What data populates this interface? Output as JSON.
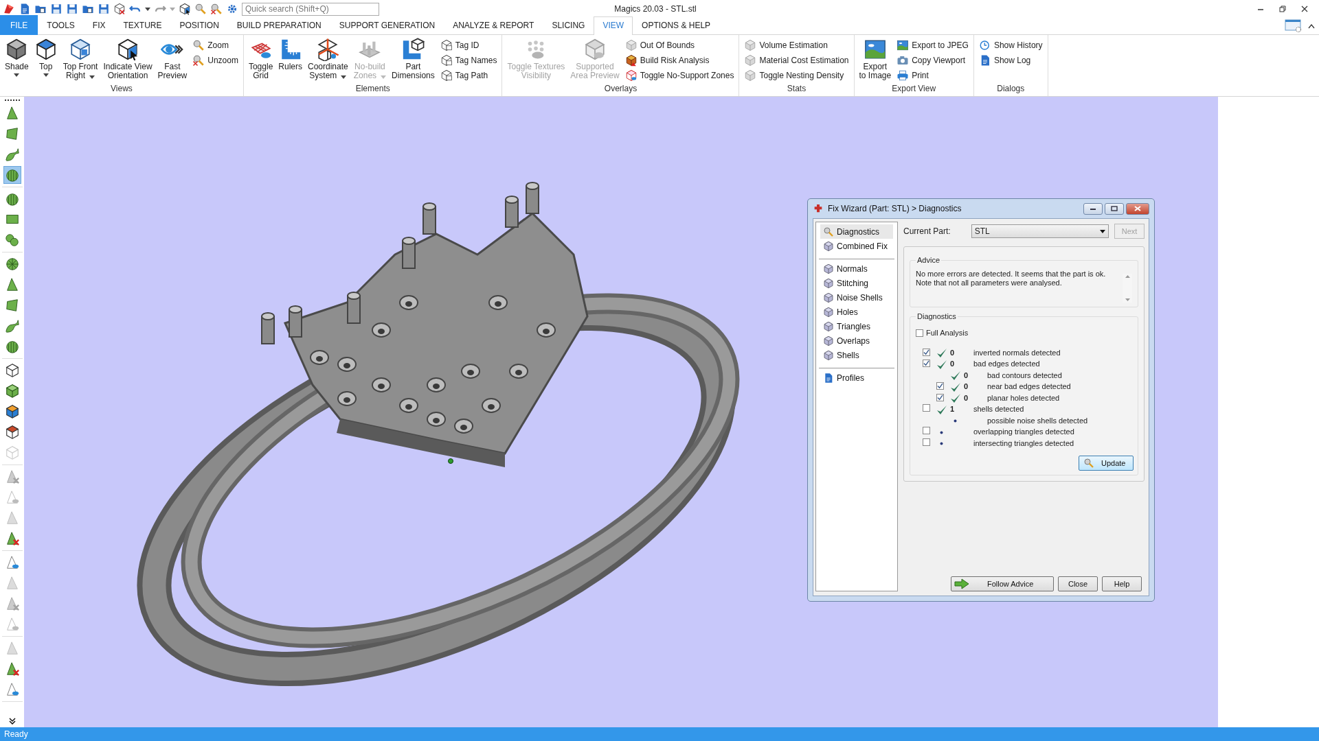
{
  "window": {
    "title": "Magics 20.03 - STL.stl"
  },
  "quick_search": {
    "placeholder": "Quick search (Shift+Q)"
  },
  "tabs": [
    {
      "label": "FILE",
      "kind": "file",
      "selected": false
    },
    {
      "label": "TOOLS",
      "kind": "tab",
      "selected": false
    },
    {
      "label": "FIX",
      "kind": "tab",
      "selected": false
    },
    {
      "label": "TEXTURE",
      "kind": "tab",
      "selected": false
    },
    {
      "label": "POSITION",
      "kind": "tab",
      "selected": false
    },
    {
      "label": "BUILD PREPARATION",
      "kind": "tab",
      "selected": false
    },
    {
      "label": "SUPPORT GENERATION",
      "kind": "tab",
      "selected": false
    },
    {
      "label": "ANALYZE & REPORT",
      "kind": "tab",
      "selected": false
    },
    {
      "label": "SLICING",
      "kind": "tab",
      "selected": false
    },
    {
      "label": "VIEW",
      "kind": "tab",
      "selected": true
    },
    {
      "label": "OPTIONS & HELP",
      "kind": "tab",
      "selected": false
    }
  ],
  "ribbon": {
    "groups": [
      {
        "label": "Views",
        "items": [
          {
            "kind": "large",
            "label": "Shade",
            "dropdown": true,
            "disabled": false
          },
          {
            "kind": "large",
            "label": "Top",
            "dropdown": true,
            "disabled": false
          },
          {
            "kind": "large",
            "label": "Top Front\nRight",
            "dropdown": true,
            "disabled": false
          },
          {
            "kind": "large",
            "label": "Indicate View\nOrientation",
            "dropdown": false,
            "disabled": false
          },
          {
            "kind": "large",
            "label": "Fast\nPreview",
            "dropdown": false,
            "disabled": false
          },
          {
            "kind": "stack",
            "items": [
              {
                "label": "Zoom",
                "disabled": false
              },
              {
                "label": "Unzoom",
                "disabled": false
              }
            ]
          }
        ]
      },
      {
        "label": "Elements",
        "items": [
          {
            "kind": "large",
            "label": "Toggle\nGrid",
            "dropdown": false,
            "disabled": false
          },
          {
            "kind": "large",
            "label": "Rulers",
            "dropdown": false,
            "disabled": false
          },
          {
            "kind": "large",
            "label": "Coordinate\nSystem",
            "dropdown": true,
            "disabled": false
          },
          {
            "kind": "large",
            "label": "No-build\nZones",
            "dropdown": true,
            "disabled": true
          },
          {
            "kind": "large",
            "label": "Part\nDimensions",
            "dropdown": false,
            "disabled": false
          },
          {
            "kind": "stack",
            "items": [
              {
                "label": "Tag ID",
                "disabled": false
              },
              {
                "label": "Tag Names",
                "disabled": false
              },
              {
                "label": "Tag Path",
                "disabled": false
              }
            ]
          }
        ]
      },
      {
        "label": "Overlays",
        "items": [
          {
            "kind": "large",
            "label": "Toggle Textures\nVisibility",
            "dropdown": false,
            "disabled": true
          },
          {
            "kind": "large",
            "label": "Supported\nArea Preview",
            "dropdown": false,
            "disabled": true
          },
          {
            "kind": "stack",
            "items": [
              {
                "label": "Out Of Bounds",
                "disabled": true
              },
              {
                "label": "Build Risk Analysis",
                "disabled": false
              },
              {
                "label": "Toggle No-Support Zones",
                "disabled": false
              }
            ]
          }
        ]
      },
      {
        "label": "Stats",
        "items": [
          {
            "kind": "stack",
            "items": [
              {
                "label": "Volume Estimation",
                "disabled": true
              },
              {
                "label": "Material Cost Estimation",
                "disabled": true
              },
              {
                "label": "Toggle Nesting Density",
                "disabled": true
              }
            ]
          }
        ]
      },
      {
        "label": "Export View",
        "items": [
          {
            "kind": "large",
            "label": "Export\nto Image",
            "dropdown": false,
            "disabled": false
          },
          {
            "kind": "stack",
            "items": [
              {
                "label": "Export to JPEG",
                "disabled": false
              },
              {
                "label": "Copy Viewport",
                "disabled": false
              },
              {
                "label": "Print",
                "disabled": false
              }
            ]
          }
        ]
      },
      {
        "label": "Dialogs",
        "items": [
          {
            "kind": "stack",
            "items": [
              {
                "label": "Show History",
                "disabled": false
              },
              {
                "label": "Show Log",
                "disabled": false
              }
            ]
          }
        ]
      }
    ]
  },
  "left_toolbar": {
    "groups": [
      {
        "tools": [
          {
            "selected": false,
            "disabled": false
          },
          {
            "selected": false,
            "disabled": false
          },
          {
            "selected": false,
            "disabled": false
          },
          {
            "selected": true,
            "disabled": false
          }
        ]
      },
      {
        "tools": [
          {
            "selected": false,
            "disabled": false
          },
          {
            "selected": false,
            "disabled": false
          },
          {
            "selected": false,
            "disabled": false
          }
        ]
      },
      {
        "tools": [
          {
            "selected": false,
            "disabled": false
          },
          {
            "selected": false,
            "disabled": false
          },
          {
            "selected": false,
            "disabled": false
          },
          {
            "selected": false,
            "disabled": false
          },
          {
            "selected": false,
            "disabled": false
          }
        ]
      },
      {
        "tools": [
          {
            "selected": false,
            "disabled": false
          },
          {
            "selected": false,
            "disabled": false
          },
          {
            "selected": false,
            "disabled": false
          },
          {
            "selected": false,
            "disabled": false
          },
          {
            "selected": false,
            "disabled": true
          }
        ]
      },
      {
        "tools": [
          {
            "selected": false,
            "disabled": true
          },
          {
            "selected": false,
            "disabled": true
          },
          {
            "selected": false,
            "disabled": true
          },
          {
            "selected": false,
            "disabled": false
          }
        ]
      },
      {
        "tools": [
          {
            "selected": false,
            "disabled": false
          },
          {
            "selected": false,
            "disabled": true
          },
          {
            "selected": false,
            "disabled": true
          },
          {
            "selected": false,
            "disabled": true
          }
        ]
      },
      {
        "tools": [
          {
            "selected": false,
            "disabled": true
          },
          {
            "selected": false,
            "disabled": false
          },
          {
            "selected": false,
            "disabled": false
          }
        ]
      }
    ]
  },
  "fix_wizard": {
    "title": "Fix Wizard (Part: STL) > Diagnostics",
    "nav_groups": [
      {
        "items": [
          {
            "label": "Diagnostics",
            "selected": true
          },
          {
            "label": "Combined Fix",
            "selected": false
          }
        ]
      },
      {
        "items": [
          {
            "label": "Normals",
            "selected": false
          },
          {
            "label": "Stitching",
            "selected": false
          },
          {
            "label": "Noise Shells",
            "selected": false
          },
          {
            "label": "Holes",
            "selected": false
          },
          {
            "label": "Triangles",
            "selected": false
          },
          {
            "label": "Overlaps",
            "selected": false
          },
          {
            "label": "Shells",
            "selected": false
          }
        ]
      },
      {
        "items": [
          {
            "label": "Profiles",
            "selected": false
          }
        ]
      }
    ],
    "current_part": {
      "label": "Current Part:",
      "value": "STL"
    },
    "next_button": {
      "label": "Next",
      "disabled": true
    },
    "advice": {
      "legend": "Advice",
      "text": "No more errors are detected. It seems that the part is ok.\nNote that not all parameters were analysed."
    },
    "diagnostics": {
      "legend": "Diagnostics",
      "full_analysis": {
        "label": "Full Analysis",
        "checked": false
      },
      "rows": [
        {
          "checked": true,
          "passed": true,
          "count": "0",
          "label": "inverted normals detected"
        },
        {
          "checked": true,
          "passed": true,
          "count": "0",
          "label": "bad edges detected",
          "children": [
            {
              "passed": true,
              "count": "0",
              "label": "bad contours detected"
            },
            {
              "checked": true,
              "passed": true,
              "count": "0",
              "label": "near bad edges detected"
            },
            {
              "checked": true,
              "passed": true,
              "count": "0",
              "label": "planar holes detected"
            }
          ]
        },
        {
          "checked": false,
          "passed": true,
          "count": "1",
          "label": "shells detected",
          "children": [
            {
              "passed": false,
              "label": "possible noise shells detected"
            }
          ]
        },
        {
          "checked": false,
          "passed": false,
          "label": "overlapping triangles detected"
        },
        {
          "checked": false,
          "passed": false,
          "label": "intersecting triangles detected"
        }
      ],
      "update_button": "Update"
    },
    "buttons": [
      {
        "label": "Follow Advice",
        "kind": "advice"
      },
      {
        "label": "Close",
        "kind": "plain"
      },
      {
        "label": "Help",
        "kind": "plain"
      }
    ]
  },
  "status_bar": {
    "text": "Ready"
  }
}
